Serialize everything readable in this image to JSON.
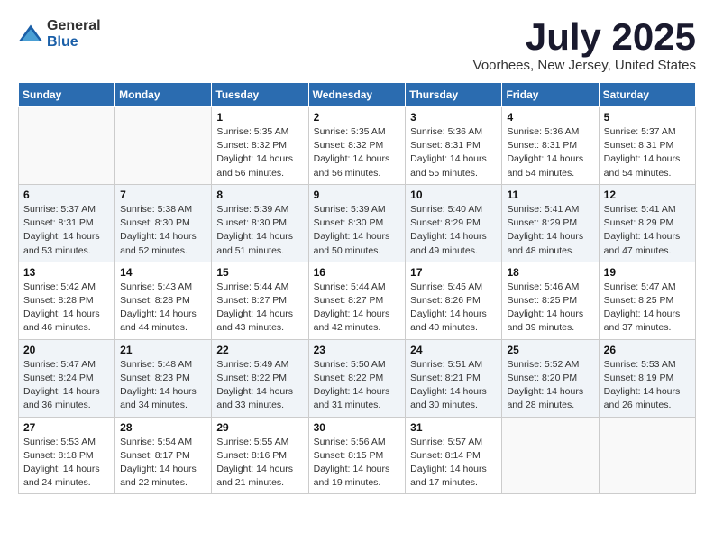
{
  "logo": {
    "general": "General",
    "blue": "Blue"
  },
  "title": "July 2025",
  "location": "Voorhees, New Jersey, United States",
  "weekdays": [
    "Sunday",
    "Monday",
    "Tuesday",
    "Wednesday",
    "Thursday",
    "Friday",
    "Saturday"
  ],
  "weeks": [
    [
      {
        "day": "",
        "detail": ""
      },
      {
        "day": "",
        "detail": ""
      },
      {
        "day": "1",
        "detail": "Sunrise: 5:35 AM\nSunset: 8:32 PM\nDaylight: 14 hours and 56 minutes."
      },
      {
        "day": "2",
        "detail": "Sunrise: 5:35 AM\nSunset: 8:32 PM\nDaylight: 14 hours and 56 minutes."
      },
      {
        "day": "3",
        "detail": "Sunrise: 5:36 AM\nSunset: 8:31 PM\nDaylight: 14 hours and 55 minutes."
      },
      {
        "day": "4",
        "detail": "Sunrise: 5:36 AM\nSunset: 8:31 PM\nDaylight: 14 hours and 54 minutes."
      },
      {
        "day": "5",
        "detail": "Sunrise: 5:37 AM\nSunset: 8:31 PM\nDaylight: 14 hours and 54 minutes."
      }
    ],
    [
      {
        "day": "6",
        "detail": "Sunrise: 5:37 AM\nSunset: 8:31 PM\nDaylight: 14 hours and 53 minutes."
      },
      {
        "day": "7",
        "detail": "Sunrise: 5:38 AM\nSunset: 8:30 PM\nDaylight: 14 hours and 52 minutes."
      },
      {
        "day": "8",
        "detail": "Sunrise: 5:39 AM\nSunset: 8:30 PM\nDaylight: 14 hours and 51 minutes."
      },
      {
        "day": "9",
        "detail": "Sunrise: 5:39 AM\nSunset: 8:30 PM\nDaylight: 14 hours and 50 minutes."
      },
      {
        "day": "10",
        "detail": "Sunrise: 5:40 AM\nSunset: 8:29 PM\nDaylight: 14 hours and 49 minutes."
      },
      {
        "day": "11",
        "detail": "Sunrise: 5:41 AM\nSunset: 8:29 PM\nDaylight: 14 hours and 48 minutes."
      },
      {
        "day": "12",
        "detail": "Sunrise: 5:41 AM\nSunset: 8:29 PM\nDaylight: 14 hours and 47 minutes."
      }
    ],
    [
      {
        "day": "13",
        "detail": "Sunrise: 5:42 AM\nSunset: 8:28 PM\nDaylight: 14 hours and 46 minutes."
      },
      {
        "day": "14",
        "detail": "Sunrise: 5:43 AM\nSunset: 8:28 PM\nDaylight: 14 hours and 44 minutes."
      },
      {
        "day": "15",
        "detail": "Sunrise: 5:44 AM\nSunset: 8:27 PM\nDaylight: 14 hours and 43 minutes."
      },
      {
        "day": "16",
        "detail": "Sunrise: 5:44 AM\nSunset: 8:27 PM\nDaylight: 14 hours and 42 minutes."
      },
      {
        "day": "17",
        "detail": "Sunrise: 5:45 AM\nSunset: 8:26 PM\nDaylight: 14 hours and 40 minutes."
      },
      {
        "day": "18",
        "detail": "Sunrise: 5:46 AM\nSunset: 8:25 PM\nDaylight: 14 hours and 39 minutes."
      },
      {
        "day": "19",
        "detail": "Sunrise: 5:47 AM\nSunset: 8:25 PM\nDaylight: 14 hours and 37 minutes."
      }
    ],
    [
      {
        "day": "20",
        "detail": "Sunrise: 5:47 AM\nSunset: 8:24 PM\nDaylight: 14 hours and 36 minutes."
      },
      {
        "day": "21",
        "detail": "Sunrise: 5:48 AM\nSunset: 8:23 PM\nDaylight: 14 hours and 34 minutes."
      },
      {
        "day": "22",
        "detail": "Sunrise: 5:49 AM\nSunset: 8:22 PM\nDaylight: 14 hours and 33 minutes."
      },
      {
        "day": "23",
        "detail": "Sunrise: 5:50 AM\nSunset: 8:22 PM\nDaylight: 14 hours and 31 minutes."
      },
      {
        "day": "24",
        "detail": "Sunrise: 5:51 AM\nSunset: 8:21 PM\nDaylight: 14 hours and 30 minutes."
      },
      {
        "day": "25",
        "detail": "Sunrise: 5:52 AM\nSunset: 8:20 PM\nDaylight: 14 hours and 28 minutes."
      },
      {
        "day": "26",
        "detail": "Sunrise: 5:53 AM\nSunset: 8:19 PM\nDaylight: 14 hours and 26 minutes."
      }
    ],
    [
      {
        "day": "27",
        "detail": "Sunrise: 5:53 AM\nSunset: 8:18 PM\nDaylight: 14 hours and 24 minutes."
      },
      {
        "day": "28",
        "detail": "Sunrise: 5:54 AM\nSunset: 8:17 PM\nDaylight: 14 hours and 22 minutes."
      },
      {
        "day": "29",
        "detail": "Sunrise: 5:55 AM\nSunset: 8:16 PM\nDaylight: 14 hours and 21 minutes."
      },
      {
        "day": "30",
        "detail": "Sunrise: 5:56 AM\nSunset: 8:15 PM\nDaylight: 14 hours and 19 minutes."
      },
      {
        "day": "31",
        "detail": "Sunrise: 5:57 AM\nSunset: 8:14 PM\nDaylight: 14 hours and 17 minutes."
      },
      {
        "day": "",
        "detail": ""
      },
      {
        "day": "",
        "detail": ""
      }
    ]
  ]
}
